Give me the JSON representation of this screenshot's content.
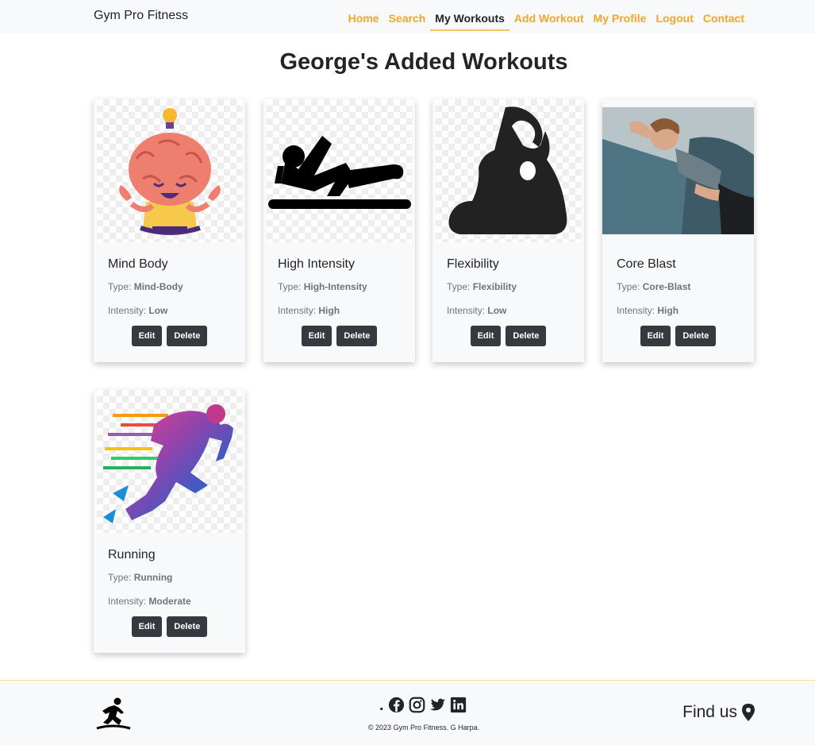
{
  "brand": "Gym Pro Fitness",
  "nav": {
    "items": [
      {
        "label": "Home"
      },
      {
        "label": "Search"
      },
      {
        "label": "My Workouts"
      },
      {
        "label": "Add Workout"
      },
      {
        "label": "My Profile"
      },
      {
        "label": "Logout"
      },
      {
        "label": "Contact"
      }
    ],
    "active": "My Workouts",
    "accent_color": "#f5a623"
  },
  "page_title": "George's Added Workouts",
  "workouts": [
    {
      "title": "Mind Body",
      "type_label": "Type:",
      "type": "Mind-Body",
      "intensity_label": "Intensity:",
      "intensity": "Low",
      "edit": "Edit",
      "delete": "Delete",
      "image": "meditating-brain-icon"
    },
    {
      "title": "High Intensity",
      "type_label": "Type:",
      "type": "High-Intensity",
      "intensity_label": "Intensity:",
      "intensity": "High",
      "edit": "Edit",
      "delete": "Delete",
      "image": "leg-raise-silhouette-icon"
    },
    {
      "title": "Flexibility",
      "type_label": "Type:",
      "type": "Flexibility",
      "intensity_label": "Intensity:",
      "intensity": "Low",
      "edit": "Edit",
      "delete": "Delete",
      "image": "yoga-pose-silhouette-icon"
    },
    {
      "title": "Core Blast",
      "type_label": "Type:",
      "type": "Core-Blast",
      "intensity_label": "Intensity:",
      "intensity": "High",
      "edit": "Edit",
      "delete": "Delete",
      "image": "crunch-photo"
    },
    {
      "title": "Running",
      "type_label": "Type:",
      "type": "Running",
      "intensity_label": "Intensity:",
      "intensity": "Moderate",
      "edit": "Edit",
      "delete": "Delete",
      "image": "colorful-runner-icon"
    }
  ],
  "footer": {
    "logo_icon": "runner-logo-icon",
    "social_prefix": ".",
    "social_icons": [
      "facebook-icon",
      "instagram-icon",
      "twitter-icon",
      "linkedin-icon"
    ],
    "copyright": "© 2023 Gym Pro Fitness. G Harpa.",
    "find_us": "Find us",
    "find_us_icon": "map-pin-icon"
  }
}
